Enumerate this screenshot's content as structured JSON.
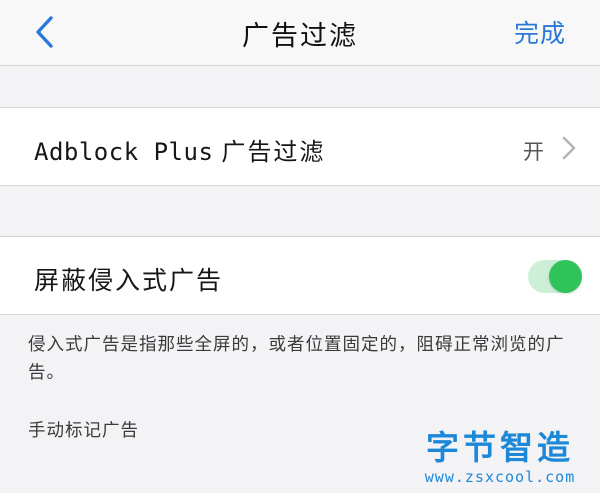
{
  "navbar": {
    "title": "广告过滤",
    "done_label": "完成"
  },
  "adblock_cell": {
    "label_latin": "Adblock Plus",
    "label_zh": "广告过滤",
    "value": "开"
  },
  "intrusive_cell": {
    "label": "屏蔽侵入式广告",
    "toggle_on": true
  },
  "footer": {
    "note": "侵入式广告是指那些全屏的，或者位置固定的，阻碍正常浏览的广告。",
    "manual_label": "手动标记广告"
  },
  "watermark": {
    "logo": "字节智造",
    "url": "www.zsxcool.com"
  },
  "colors": {
    "accent": "#2a78d8",
    "toggle_on": "#2fc35a",
    "watermark": "#1e88d8"
  },
  "icons": {
    "back": "chevron-left-icon",
    "disclosure": "chevron-right-icon"
  }
}
